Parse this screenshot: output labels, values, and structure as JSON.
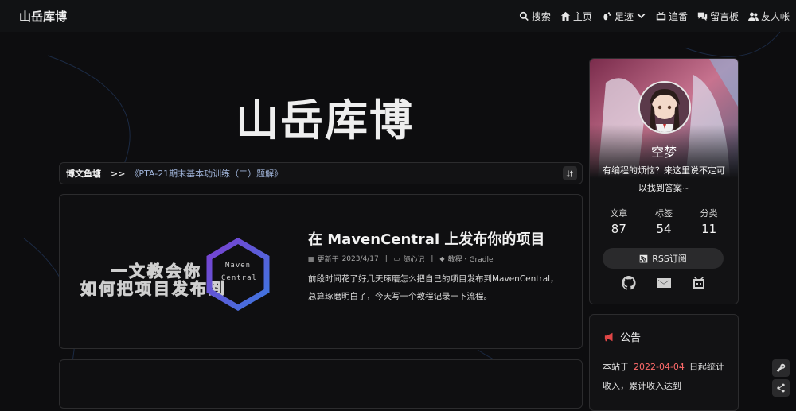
{
  "site": {
    "name": "山岳库博"
  },
  "nav": {
    "items": [
      {
        "label": "搜索",
        "icon": "search-icon"
      },
      {
        "label": "主页",
        "icon": "home-icon"
      },
      {
        "label": "足迹",
        "icon": "footprint-icon"
      },
      {
        "label": "追番",
        "icon": "tv-icon"
      },
      {
        "label": "留言板",
        "icon": "comments-icon"
      },
      {
        "label": "友人帐",
        "icon": "users-icon"
      }
    ]
  },
  "hero": {
    "title": "山岳库博"
  },
  "breadcrumb": {
    "home": "博文鱼塘",
    "separator": ">>",
    "current": "《PTA-21期末基本功训练（二）题解》"
  },
  "post": {
    "cover_line1": "一文教会你",
    "cover_line2": "如何把项目发布到",
    "cover_logo_line1": "Maven",
    "cover_logo_line2": "Central",
    "title": "在 MavenCentral 上发布你的项目",
    "updated_label": "更新于",
    "updated_date": "2023/4/17",
    "meta_separator": "|",
    "category": "随心记",
    "tags": "教程・Gradle",
    "excerpt": "前段时间花了好几天琢磨怎么把自己的项目发布到MavenCentral，总算琢磨明白了，今天写一个教程记录一下流程。"
  },
  "profile": {
    "name": "空梦",
    "description": "有编程的烦恼？来这里说不定可以找到答案~",
    "stats": [
      {
        "label": "文章",
        "value": "87"
      },
      {
        "label": "标签",
        "value": "54"
      },
      {
        "label": "分类",
        "value": "11"
      }
    ],
    "rss_label": "RSS订阅",
    "social_icons": [
      "github-icon",
      "mail-icon",
      "bilibili-icon"
    ]
  },
  "notice": {
    "title": "公告",
    "text_before": "本站于",
    "date": "2022-04-04",
    "text_after": "日起统计收入，累计收入达到"
  },
  "colors": {
    "accent_red": "#e04646",
    "date_red": "#ff6b6b",
    "link_blue": "#9fb3d8",
    "background": "#0d0d0f"
  }
}
